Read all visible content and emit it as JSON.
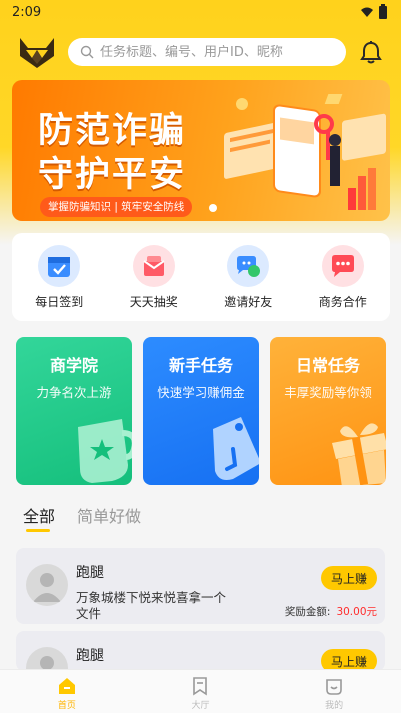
{
  "status_bar": {
    "time": "2:09"
  },
  "search": {
    "placeholder": "任务标题、编号、用户ID、昵称"
  },
  "banner": {
    "line1": "防范诈骗",
    "line2": "守护平安",
    "subtitle": "掌握防骗知识 | 筑牢安全防线"
  },
  "quick_actions": [
    {
      "label": "每日签到",
      "icon": "calendar-check-icon",
      "color": "#3a8dff"
    },
    {
      "label": "天天抽奖",
      "icon": "gift-box-icon",
      "color": "#ff5a66"
    },
    {
      "label": "邀请好友",
      "icon": "chat-bubble-icon",
      "color": "#3a8dff"
    },
    {
      "label": "商务合作",
      "icon": "message-icon",
      "color": "#ff4a55"
    }
  ],
  "feature_cards": [
    {
      "title": "商学院",
      "subtitle": "力争名次上游",
      "icon": "trophy-cup-icon"
    },
    {
      "title": "新手任务",
      "subtitle": "快速学习赚佣金",
      "icon": "tag-icon"
    },
    {
      "title": "日常任务",
      "subtitle": "丰厚奖励等你领",
      "icon": "gift-icon"
    }
  ],
  "tabs": [
    {
      "label": "全部",
      "active": true
    },
    {
      "label": "简单好做",
      "active": false
    }
  ],
  "tasks": [
    {
      "title": "跑腿",
      "description": "万象城楼下悦来悦喜拿一个文件",
      "button": "马上赚",
      "reward_label": "奖励金额:",
      "reward_amount": "30.00元"
    },
    {
      "title": "跑腿",
      "button": "马上赚"
    }
  ],
  "bottom_nav": [
    {
      "label": "首页",
      "icon": "home-icon",
      "active": true
    },
    {
      "label": "大厅",
      "icon": "bookmark-icon",
      "active": false
    },
    {
      "label": "我的",
      "icon": "smile-face-icon",
      "active": false
    }
  ],
  "colors": {
    "brand_yellow": "#ffd21c",
    "accent_button": "#ffc800",
    "reward_red": "#ff2d2d"
  }
}
